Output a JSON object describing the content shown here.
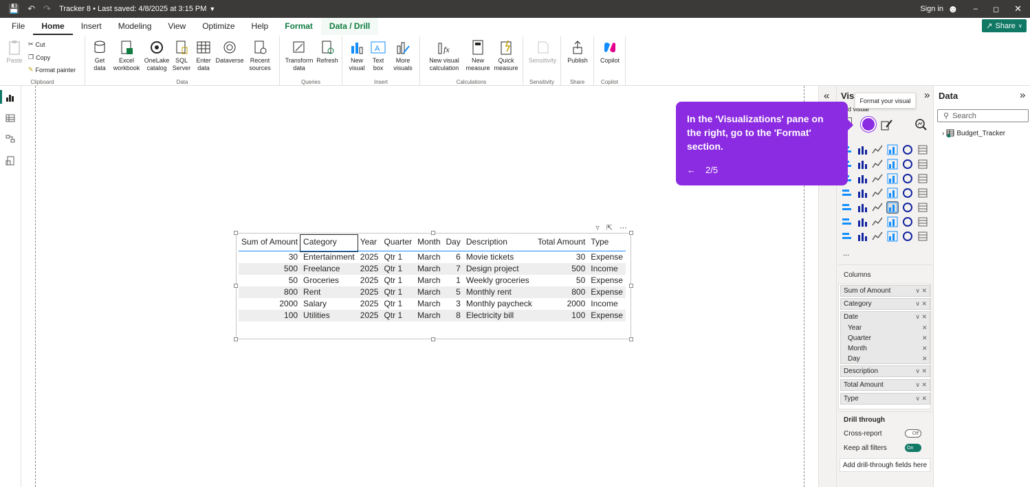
{
  "titlebar": {
    "title": "Tracker 8 • Last saved: 4/8/2025 at 3:15 PM",
    "sign_in": "Sign in",
    "share_label": "Share"
  },
  "menu": {
    "file": "File",
    "home": "Home",
    "insert": "Insert",
    "modeling": "Modeling",
    "view": "View",
    "optimize": "Optimize",
    "help": "Help",
    "format": "Format",
    "data_drill": "Data / Drill"
  },
  "ribbon": {
    "clipboard": {
      "label": "Clipboard",
      "paste": "Paste",
      "cut": "Cut",
      "copy": "Copy",
      "format_painter": "Format painter"
    },
    "data": {
      "label": "Data",
      "get_data": "Get data",
      "excel": "Excel workbook",
      "onelake": "OneLake catalog",
      "sql": "SQL Server",
      "enter": "Enter data",
      "dataverse": "Dataverse",
      "recent": "Recent sources"
    },
    "queries": {
      "label": "Queries",
      "transform": "Transform data",
      "refresh": "Refresh"
    },
    "insert": {
      "label": "Insert",
      "new_visual": "New visual",
      "text_box": "Text box",
      "more_visuals": "More visuals"
    },
    "calculations": {
      "label": "Calculations",
      "new_visual_calc": "New visual calculation",
      "new_measure": "New measure",
      "quick_measure": "Quick measure"
    },
    "sensitivity": {
      "label": "Sensitivity",
      "sensitivity": "Sensitivity"
    },
    "share": {
      "label": "Share",
      "publish": "Publish"
    },
    "copilot": {
      "label": "Copilot",
      "copilot": "Copilot"
    }
  },
  "table": {
    "headers": [
      "Sum of Amount",
      "Category",
      "Year",
      "Quarter",
      "Month",
      "Day",
      "Description",
      "Total Amount",
      "Type"
    ],
    "rows": [
      [
        "30",
        "Entertainment",
        "2025",
        "Qtr 1",
        "March",
        "6",
        "Movie tickets",
        "30",
        "Expense"
      ],
      [
        "500",
        "Freelance",
        "2025",
        "Qtr 1",
        "March",
        "7",
        "Design project",
        "500",
        "Income"
      ],
      [
        "50",
        "Groceries",
        "2025",
        "Qtr 1",
        "March",
        "1",
        "Weekly groceries",
        "50",
        "Expense"
      ],
      [
        "800",
        "Rent",
        "2025",
        "Qtr 1",
        "March",
        "5",
        "Monthly rent",
        "800",
        "Expense"
      ],
      [
        "2000",
        "Salary",
        "2025",
        "Qtr 1",
        "March",
        "3",
        "Monthly paycheck",
        "2000",
        "Income"
      ],
      [
        "100",
        "Utilities",
        "2025",
        "Qtr 1",
        "March",
        "8",
        "Electricity bill",
        "100",
        "Expense"
      ]
    ]
  },
  "viz_pane": {
    "title": "Visu",
    "build_visual": "uild visual",
    "tooltip": "Format your visual",
    "columns_label": "Columns",
    "wells": [
      "Sum of Amount",
      "Category",
      "Date",
      "Description",
      "Total Amount",
      "Type"
    ],
    "date_subfields": [
      "Year",
      "Quarter",
      "Month",
      "Day"
    ],
    "drill_through": "Drill through",
    "cross_report": "Cross-report",
    "cross_report_state": "Off",
    "keep_all_filters": "Keep all filters",
    "keep_all_filters_state": "On",
    "add_drill": "Add drill-through fields here",
    "more": "..."
  },
  "data_pane": {
    "title": "Data",
    "search_placeholder": "Search",
    "table_name": "Budget_Tracker"
  },
  "callout": {
    "text": "In the 'Visualizations' pane on the right, go to the 'Format' section.",
    "back": "←",
    "step": "2/5"
  },
  "colors": {
    "callout": "#8b2be2",
    "accent": "#117865",
    "header_underline": "#118dff"
  }
}
